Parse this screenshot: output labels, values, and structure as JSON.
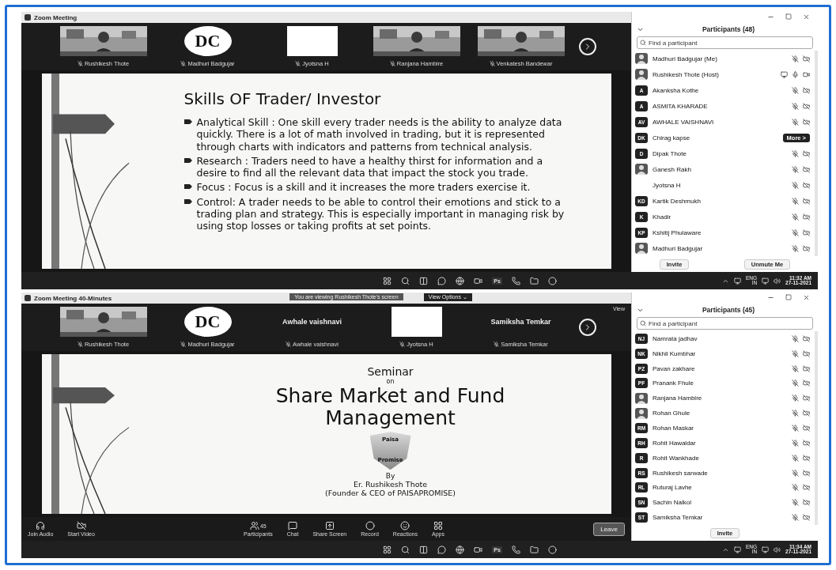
{
  "screens": [
    {
      "window_title": "Zoom Meeting",
      "videos": [
        {
          "kind": "camera",
          "name": "Rushikesh Thote"
        },
        {
          "kind": "logo",
          "logo": "DC",
          "name": "Madhuri Badgujar"
        },
        {
          "kind": "blank",
          "name": "Jyotsna H"
        },
        {
          "kind": "camera",
          "name": "Ranjana Hambire"
        },
        {
          "kind": "camera",
          "name": "Venkatesh Bandewar"
        }
      ],
      "slide": {
        "kind": "bullets",
        "title": "Skills OF Trader/ Investor",
        "bullets": [
          "Analytical Skill : One skill every trader needs is the ability to analyze data quickly. There is a lot of math involved in trading, but it is represented through charts with indicators and patterns from technical analysis.",
          "Research : Traders need to have a healthy thirst for information and a desire to find all the relevant data that impact the stock you trade.",
          "Focus : Focus is a skill and it increases the more traders exercise it.",
          "Control: A trader needs to be able to control their emotions and stick to a trading plan and strategy. This is especially important in managing risk by using stop losses or taking profits at set points."
        ]
      },
      "participants": {
        "title": "Participants (48)",
        "search_placeholder": "Find a participant",
        "items": [
          {
            "name": "Madhuri Badgujar (Me)",
            "kind": "muted"
          },
          {
            "name": "Rushikesh Thote (Host)",
            "kind": "host"
          },
          {
            "name": "Akanksha Kothe",
            "avatar": {
              "kind": "initials",
              "initials": "A"
            },
            "kind": "muted"
          },
          {
            "name": "ASMITA KHARADE",
            "avatar": {
              "kind": "initials",
              "initials": "A"
            },
            "kind": "muted"
          },
          {
            "name": "AWHALE VAISHNAVI",
            "avatar": {
              "kind": "initials",
              "initials": "AV"
            },
            "kind": "muted"
          },
          {
            "name": "Chirag kapse",
            "avatar": {
              "kind": "initials",
              "initials": "DK"
            },
            "kind": "more",
            "more": "More >"
          },
          {
            "name": "Dipak Thote",
            "avatar": {
              "kind": "initials",
              "initials": "D"
            },
            "kind": "muted"
          },
          {
            "name": "Ganesh Rakh",
            "kind": "muted"
          },
          {
            "name": "Jyotsna H",
            "kind": "muted"
          },
          {
            "name": "Kartik Deshmukh",
            "avatar": {
              "kind": "initials",
              "initials": "KD"
            },
            "kind": "muted"
          },
          {
            "name": "Khadir",
            "avatar": {
              "kind": "initials",
              "initials": "K"
            },
            "kind": "muted"
          },
          {
            "name": "Kshitij Phulaware",
            "avatar": {
              "kind": "initials",
              "initials": "KP"
            },
            "kind": "muted"
          },
          {
            "name": "Madhuri Badgujar",
            "kind": "muted"
          }
        ],
        "buttons": [
          "Invite",
          "Unmute Me"
        ]
      },
      "taskbar": {
        "ps": "Ps",
        "lang": "ENG",
        "region": "IN",
        "time": "11:32 AM",
        "date": "27-11-2021"
      }
    },
    {
      "window_title": "Zoom Meeting 40-Minutes",
      "banner": "You are viewing Rushikesh Thote's screen",
      "view_options": "View Options ⌄",
      "view_label": "View",
      "videos": [
        {
          "kind": "camera",
          "name": "Rushikesh Thote"
        },
        {
          "kind": "logo",
          "logo": "DC",
          "name": "Madhuri Badgujar"
        },
        {
          "kind": "name",
          "big": "Awhale vaishnavi",
          "name": "Awhale vaishnavi"
        },
        {
          "kind": "blank",
          "name": "Jyotsna H"
        },
        {
          "kind": "name",
          "big": "Samiksha Temkar",
          "name": "Samiksha Temkar"
        }
      ],
      "slide": {
        "kind": "title",
        "pre": "Seminar",
        "on": "on",
        "title": "Share Market and Fund Management",
        "logo_top": "Paisa",
        "logo_bottom": "Promise",
        "by": "By",
        "author": "Er. Rushikesh Thote",
        "role": "(Founder & CEO of PAISAPROMISE)"
      },
      "toolbar": {
        "items": [
          {
            "kind": "audio",
            "label": "Join Audio"
          },
          {
            "kind": "video",
            "label": "Start Video"
          },
          {
            "kind": "participants",
            "label": "Participants",
            "count": "45"
          },
          {
            "kind": "chat",
            "label": "Chat"
          },
          {
            "kind": "share",
            "label": "Share Screen"
          },
          {
            "kind": "record",
            "label": "Record"
          },
          {
            "kind": "reactions",
            "label": "Reactions"
          },
          {
            "kind": "apps",
            "label": "Apps"
          }
        ],
        "leave": "Leave"
      },
      "participants": {
        "title": "Participants (45)",
        "search_placeholder": "Find a participant",
        "items": [
          {
            "name": "Namrata jadhav",
            "avatar": {
              "kind": "initials",
              "initials": "NJ"
            },
            "kind": "muted"
          },
          {
            "name": "Nikhil Kumbhar",
            "avatar": {
              "kind": "initials",
              "initials": "NK"
            },
            "kind": "muted"
          },
          {
            "name": "Pavan zakhare",
            "avatar": {
              "kind": "initials",
              "initials": "PZ"
            },
            "kind": "muted"
          },
          {
            "name": "Pranank Fhule",
            "avatar": {
              "kind": "initials",
              "initials": "PF"
            },
            "kind": "muted"
          },
          {
            "name": "Ranjana Hambire",
            "kind": "muted"
          },
          {
            "name": "Rohan Ghule",
            "kind": "muted"
          },
          {
            "name": "Rohan Maskar",
            "avatar": {
              "kind": "initials",
              "initials": "RM"
            },
            "kind": "muted"
          },
          {
            "name": "Rohit Hawaldar",
            "avatar": {
              "kind": "initials",
              "initials": "RH"
            },
            "kind": "muted"
          },
          {
            "name": "Rohit Wankhade",
            "avatar": {
              "kind": "initials",
              "initials": "R"
            },
            "kind": "muted"
          },
          {
            "name": "Rushikesh sarwade",
            "avatar": {
              "kind": "initials",
              "initials": "RS"
            },
            "kind": "muted"
          },
          {
            "name": "Ruturaj Lavhe",
            "avatar": {
              "kind": "initials",
              "initials": "RL"
            },
            "kind": "muted"
          },
          {
            "name": "Sachin Nalkol",
            "avatar": {
              "kind": "initials",
              "initials": "SN"
            },
            "kind": "muted"
          },
          {
            "name": "Samiksha Temkar",
            "avatar": {
              "kind": "initials",
              "initials": "ST"
            },
            "kind": "muted"
          }
        ],
        "buttons": [
          "Invite"
        ]
      },
      "taskbar": {
        "ps": "Ps",
        "lang": "ENG",
        "region": "IN",
        "time": "11:34 AM",
        "date": "27-11-2021"
      }
    }
  ]
}
